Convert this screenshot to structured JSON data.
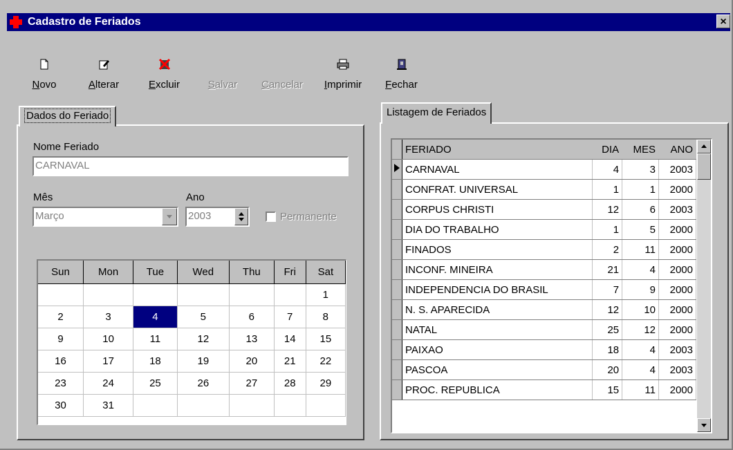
{
  "window": {
    "title": "Cadastro de Feriados",
    "close_label": "×"
  },
  "toolbar": [
    {
      "key": "novo",
      "label": "Novo",
      "disabled": false
    },
    {
      "key": "alterar",
      "label": "Alterar",
      "disabled": false
    },
    {
      "key": "excluir",
      "label": "Excluir",
      "disabled": false
    },
    {
      "key": "salvar",
      "label": "Salvar",
      "disabled": true
    },
    {
      "key": "cancelar",
      "label": "Cancelar",
      "disabled": true
    },
    {
      "key": "imprimir",
      "label": "Imprimir",
      "disabled": false
    },
    {
      "key": "fechar",
      "label": "Fechar",
      "disabled": false
    }
  ],
  "left_tab": {
    "title": "Dados do Feriado",
    "nome_label": "Nome Feriado",
    "nome_value": "CARNAVAL",
    "mes_label": "Mês",
    "mes_value": "Março",
    "ano_label": "Ano",
    "ano_value": "2003",
    "permanente_label": "Permanente"
  },
  "calendar": {
    "days_header": [
      "Sun",
      "Mon",
      "Tue",
      "Wed",
      "Thu",
      "Fri",
      "Sat"
    ],
    "weeks": [
      [
        "",
        "",
        "",
        "",
        "",
        "",
        "1"
      ],
      [
        "2",
        "3",
        "4",
        "5",
        "6",
        "7",
        "8"
      ],
      [
        "9",
        "10",
        "11",
        "12",
        "13",
        "14",
        "15"
      ],
      [
        "16",
        "17",
        "18",
        "19",
        "20",
        "21",
        "22"
      ],
      [
        "23",
        "24",
        "25",
        "26",
        "27",
        "28",
        "29"
      ],
      [
        "30",
        "31",
        "",
        "",
        "",
        "",
        ""
      ]
    ],
    "selected_day": "4"
  },
  "right_tab": {
    "title": "Listagem de Feriados",
    "columns": [
      "FERIADO",
      "DIA",
      "MES",
      "ANO"
    ],
    "rows": [
      [
        "CARNAVAL",
        "4",
        "3",
        "2003"
      ],
      [
        "CONFRAT. UNIVERSAL",
        "1",
        "1",
        "2000"
      ],
      [
        "CORPUS CHRISTI",
        "12",
        "6",
        "2003"
      ],
      [
        "DIA DO TRABALHO",
        "1",
        "5",
        "2000"
      ],
      [
        "FINADOS",
        "2",
        "11",
        "2000"
      ],
      [
        "INCONF. MINEIRA",
        "21",
        "4",
        "2000"
      ],
      [
        "INDEPENDENCIA DO BRASIL",
        "7",
        "9",
        "2000"
      ],
      [
        "N. S. APARECIDA",
        "12",
        "10",
        "2000"
      ],
      [
        "NATAL",
        "25",
        "12",
        "2000"
      ],
      [
        "PAIXAO",
        "18",
        "4",
        "2003"
      ],
      [
        "PASCOA",
        "20",
        "4",
        "2003"
      ],
      [
        "PROC. REPUBLICA",
        "15",
        "11",
        "2000"
      ]
    ],
    "current_row": 0
  }
}
